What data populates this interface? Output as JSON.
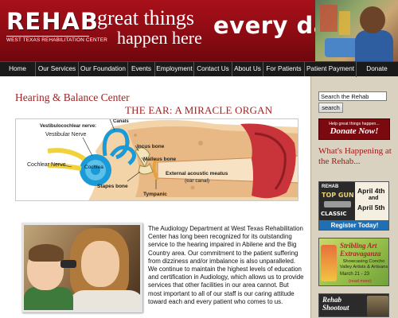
{
  "header": {
    "logo_text": "REHAB",
    "logo_subtitle": "WEST TEXAS REHABILITATION CENTER",
    "tagline_line1": "great things",
    "tagline_line2": "happen here",
    "tagline_line3": "every day!"
  },
  "nav": {
    "items": [
      {
        "label": "Home"
      },
      {
        "label": "Our Services"
      },
      {
        "label": "Our Foundation"
      },
      {
        "label": "Events"
      },
      {
        "label": "Employment"
      },
      {
        "label": "Contact Us"
      },
      {
        "label": "About Us"
      },
      {
        "label": "For Patients"
      },
      {
        "label": "Patient Payment"
      },
      {
        "label": "Donate"
      }
    ]
  },
  "main": {
    "section_title": "Hearing & Balance Center",
    "page_heading": "THE EAR:  A MIRACLE ORGAN",
    "ear_diagram": {
      "labels": {
        "canals": "Canals",
        "vestibulocochlear": "Vestibulocochlear nerve:",
        "vestibular": "Vestibular Nerve",
        "cochlear_nerve": "Cochlear Nerve",
        "cochlea": "Cochlea",
        "incus": "Incus bone",
        "malleus": "Malleus bone",
        "stapes": "Stapes bone",
        "tympanic": "Tympanic",
        "meatus": "External acoustic meatus",
        "ear_canal": "(ear canal)"
      }
    },
    "body_text": "The Audiology Department at West Texas Rehabilitation Center has long been recognized for its outstanding service to the hearing impaired in Abilene and the Big Country area.  Our commitment to the patient suffering from dizziness and/or imbalance is also unparalleled.  We continue to maintain the highest levels of education and certification in Audiology, which allows us to provide services that other facilities in our area cannot.  But most important to all of our staff is our caring attitude toward each and every patient who comes to us."
  },
  "sidebar": {
    "search": {
      "value": "Search the Rehab",
      "button_label": "search"
    },
    "donate": {
      "small_text": "Help great things happen...",
      "big_text": "Donate Now!"
    },
    "whats_happening": "What's Happening at the Rehab...",
    "promo_top_gun": {
      "rehab": "REHAB",
      "title": "TOP GUN",
      "classic": "CLASSIC",
      "date1": "April 4th",
      "date1_and": "and",
      "date2": "April 5th",
      "register": "Register Today!"
    },
    "promo_stribling": {
      "title_line1": "Stribling Art",
      "title_line2": "Extravaganza",
      "subtitle": "Showcasing Concho Valley Artists & Artisans",
      "date": "March 21 - 23",
      "more": "(read more)"
    },
    "promo_shootout": {
      "title_line1": "Rehab",
      "title_line2": "Shootout"
    }
  },
  "colors": {
    "header_red": "#8a0b12",
    "nav_bg": "#1a1a1a",
    "heading_red": "#9e2323",
    "sidebar_bg": "#d9d2c0",
    "register_blue": "#1e6fb4"
  }
}
